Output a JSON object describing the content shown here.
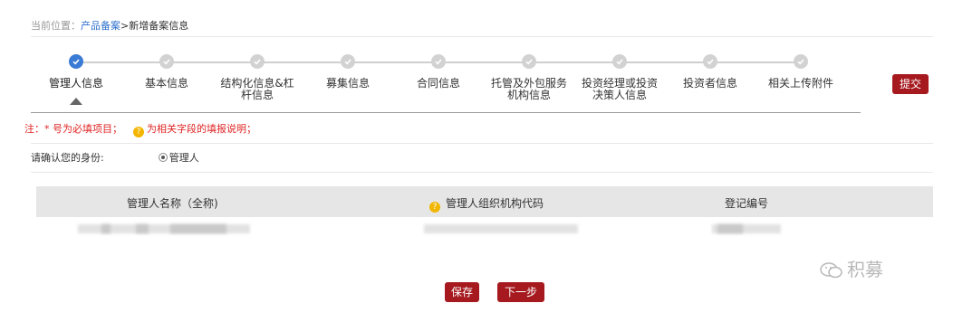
{
  "breadcrumb": {
    "prefix": "当前位置：",
    "link": "产品备案",
    "separator": ">",
    "current": "新增备案信息"
  },
  "steps": [
    {
      "label": "管理人信息",
      "state": "completed"
    },
    {
      "label": "基本信息",
      "state": "pending"
    },
    {
      "label": "结构化信息&杠杆信息",
      "state": "pending"
    },
    {
      "label": "募集信息",
      "state": "pending"
    },
    {
      "label": "合同信息",
      "state": "pending"
    },
    {
      "label": "托管及外包服务机构信息",
      "state": "pending"
    },
    {
      "label": "投资经理或投资决策人信息",
      "state": "pending"
    },
    {
      "label": "投资者信息",
      "state": "pending"
    },
    {
      "label": "相关上传附件",
      "state": "pending"
    }
  ],
  "submit_label": "提交",
  "note": {
    "required_text": "注：* 号为必填项目；",
    "help_text": "为相关字段的填报说明；",
    "help_icon_glyph": "?"
  },
  "identity": {
    "label": "请确认您的身份:",
    "option": "管理人"
  },
  "table": {
    "columns": [
      "管理人名称（全称)",
      "管理人组织机构代码",
      "登记编号"
    ],
    "help_icon_glyph": "?"
  },
  "watermark": "积募",
  "buttons": {
    "save": "保存",
    "next": "下一步"
  },
  "colors": {
    "accent_blue": "#3a7bd5",
    "brand_red": "#a5191f",
    "note_red": "#e02424",
    "help_yellow": "#f2b600"
  }
}
